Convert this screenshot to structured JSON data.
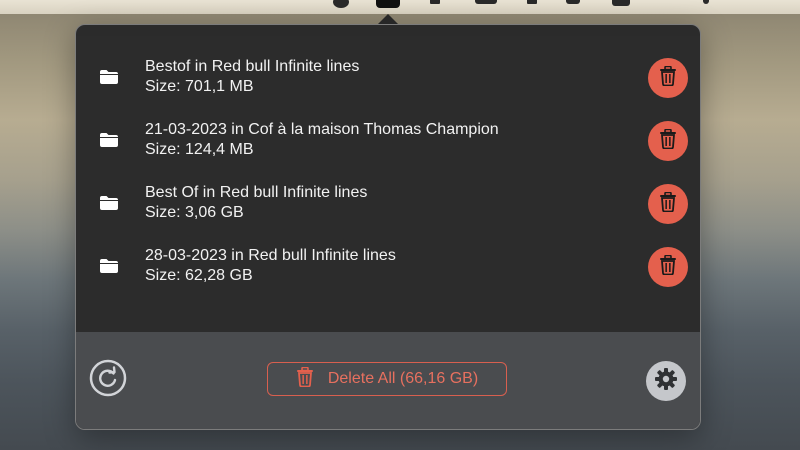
{
  "menubar": {
    "icons": [
      "menubar-app-icon",
      "menubar-active-app-icon",
      "menubar-status-icon",
      "menubar-status-icon",
      "menubar-status-icon",
      "menubar-status-icon",
      "menubar-status-icon",
      "menubar-status-icon"
    ]
  },
  "downloads": {
    "items": [
      {
        "title": "Bestof in Red bull Infinite lines",
        "size": "Size: 701,1 MB"
      },
      {
        "title": "21-03-2023 in Cof à la maison Thomas Champion",
        "size": "Size: 124,4 MB"
      },
      {
        "title": "Best Of in Red bull Infinite lines",
        "size": "Size: 3,06 GB"
      },
      {
        "title": "28-03-2023 in Red bull Infinite lines",
        "size": "Size: 62,28 GB"
      }
    ],
    "item_icon": "folder-icon",
    "delete_icon": "trash-icon"
  },
  "footer": {
    "refresh_icon": "refresh-icon",
    "delete_all_label": "Delete All (66,16 GB)",
    "settings_icon": "gear-icon"
  },
  "colors": {
    "accent_red": "#e4604d",
    "panel_bg": "#2c2c2c",
    "footer_bg": "#4a4c4f",
    "text": "#f2f2f2"
  }
}
